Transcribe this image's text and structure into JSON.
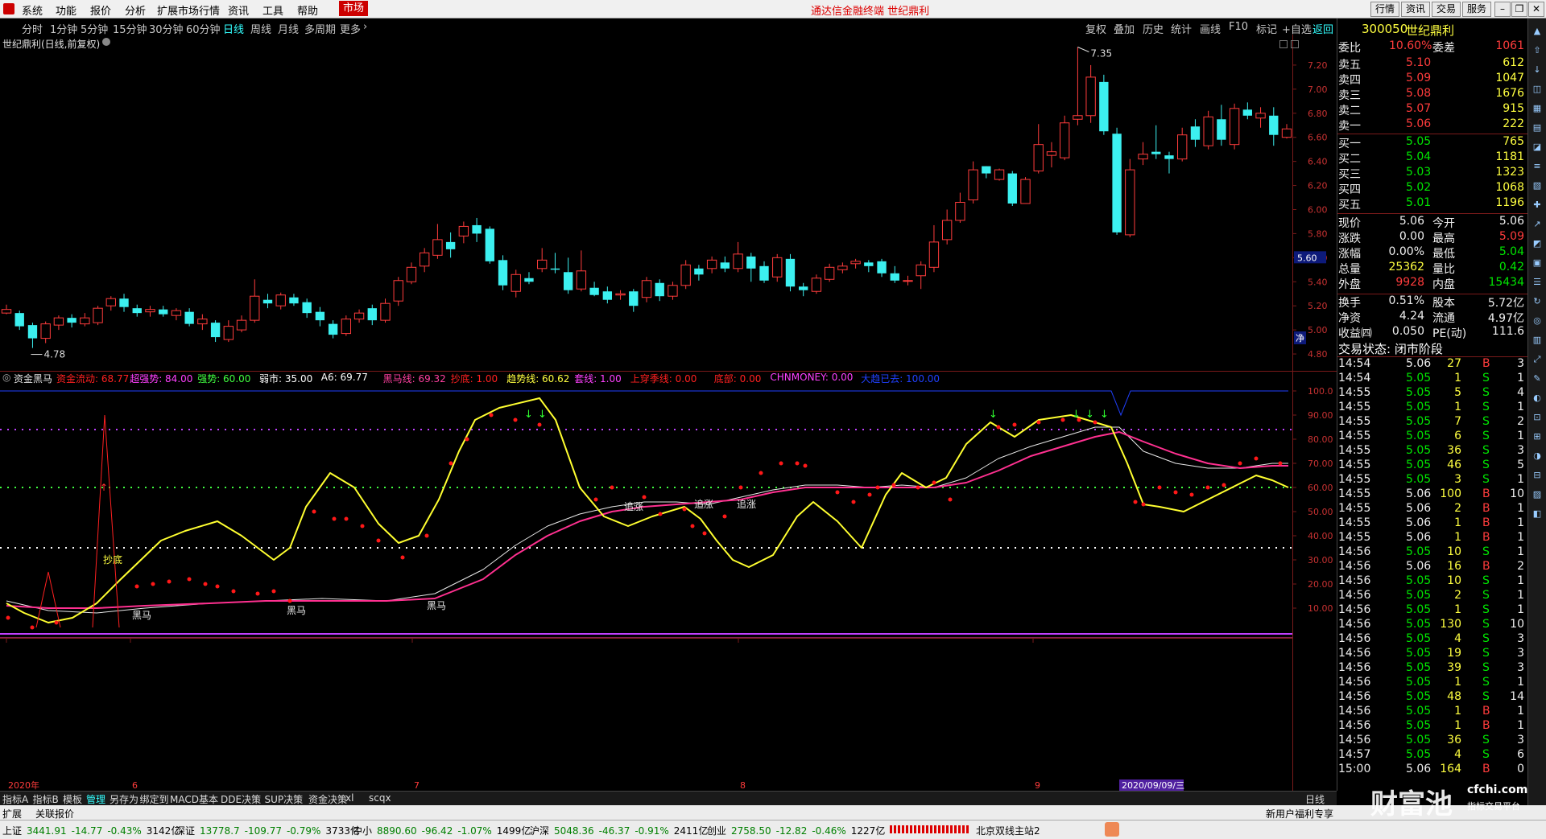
{
  "menu": {
    "items": [
      "系统",
      "功能",
      "报价",
      "分析",
      "扩展市场行情",
      "资讯",
      "工具",
      "帮助"
    ],
    "active": "市场",
    "ad_text": "通达信金融终端  世纪鼎利",
    "right_buttons": [
      "行情",
      "资讯",
      "交易",
      "服务"
    ]
  },
  "periods": [
    "分时",
    "1分钟",
    "5分钟",
    "15分钟",
    "30分钟",
    "60分钟",
    "日线",
    "周线",
    "月线",
    "多周期",
    "更多"
  ],
  "selected_period": "日线",
  "toolbar_right": [
    "复权",
    "叠加",
    "历史",
    "统计",
    "画线",
    "F10",
    "标记",
    "+自选",
    "返回"
  ],
  "stock": {
    "code": "300050",
    "name": "世纪鼎利"
  },
  "chart_title": "世纪鼎利(日线,前复权)",
  "price_axis": [
    "7.20",
    "7.00",
    "6.80",
    "6.60",
    "6.40",
    "6.20",
    "6.00",
    "5.80",
    "5.60",
    "5.40",
    "5.20",
    "5.00",
    "4.80"
  ],
  "price_marker": "5.60",
  "high_label": "7.35",
  "low_label": "4.78",
  "indicator": {
    "name": "资金黑马",
    "values": [
      {
        "label": "资金流动: 68.77",
        "color": "#ff2020"
      },
      {
        "label": "超强势: 84.00",
        "color": "#ff40ff"
      },
      {
        "label": "强势: 60.00",
        "color": "#40ff40"
      },
      {
        "label": "弱市: 35.00",
        "color": "#ffffff"
      },
      {
        "label": "A6: 69.77",
        "color": "#ffffff"
      },
      {
        "label": "黑马线: 69.32",
        "color": "#ff40a0"
      },
      {
        "label": "抄底: 1.00",
        "color": "#ff2020"
      },
      {
        "label": "趋势线: 60.62",
        "color": "#ffff40"
      },
      {
        "label": "套线: 1.00",
        "color": "#ff40ff"
      },
      {
        "label": "上穿季线: 0.00",
        "color": "#ff2020"
      },
      {
        "label": "底部: 0.00",
        "color": "#ff2020"
      },
      {
        "label": "CHNMONEY: 0.00",
        "color": "#ff40ff"
      },
      {
        "label": "大趋已去: 100.00",
        "color": "#2040ff"
      }
    ],
    "axis": [
      "100.0",
      "90.00",
      "80.00",
      "70.00",
      "60.00",
      "50.00",
      "40.00",
      "30.00",
      "20.00",
      "10.00"
    ],
    "labels": {
      "dima": "黑马",
      "chaodi": "抄底",
      "zhuizhang": "追涨"
    }
  },
  "date_axis": [
    {
      "label": "2020年",
      "color": "#ff3c3c"
    },
    {
      "label": "6",
      "color": "#ff3c3c"
    },
    {
      "label": "7",
      "color": "#ff3c3c"
    },
    {
      "label": "8",
      "color": "#ff3c3c"
    },
    {
      "label": "9",
      "color": "#ff3c3c"
    }
  ],
  "date_cursor": "2020/09/09/三",
  "bottom_tabs": [
    "指标A",
    "指标B",
    "模板",
    "管理",
    "另存为",
    "绑定到",
    "MACD基本",
    "DDE决策",
    "SUP决策",
    "资金决策",
    "xl",
    "scqx"
  ],
  "selected_tab": "管理",
  "daily_label": "日线",
  "order_book": {
    "weibi": {
      "label": "委比",
      "value": "10.60%",
      "label2": "委差",
      "value2": "1061"
    },
    "sells": [
      {
        "label": "卖五",
        "price": "5.10",
        "vol": "612"
      },
      {
        "label": "卖四",
        "price": "5.09",
        "vol": "1047"
      },
      {
        "label": "卖三",
        "price": "5.08",
        "vol": "1676"
      },
      {
        "label": "卖二",
        "price": "5.07",
        "vol": "915"
      },
      {
        "label": "卖一",
        "price": "5.06",
        "vol": "222"
      }
    ],
    "buys": [
      {
        "label": "买一",
        "price": "5.05",
        "vol": "765"
      },
      {
        "label": "买二",
        "price": "5.04",
        "vol": "1181"
      },
      {
        "label": "买三",
        "price": "5.03",
        "vol": "1323"
      },
      {
        "label": "买四",
        "price": "5.02",
        "vol": "1068"
      },
      {
        "label": "买五",
        "price": "5.01",
        "vol": "1196"
      }
    ]
  },
  "quote": [
    {
      "l1": "现价",
      "v1": "5.06",
      "c1": "white",
      "l2": "今开",
      "v2": "5.06",
      "c2": "white"
    },
    {
      "l1": "涨跌",
      "v1": "0.00",
      "c1": "white",
      "l2": "最高",
      "v2": "5.09",
      "c2": "red"
    },
    {
      "l1": "涨幅",
      "v1": "0.00%",
      "c1": "white",
      "l2": "最低",
      "v2": "5.04",
      "c2": "green"
    },
    {
      "l1": "总量",
      "v1": "25362",
      "c1": "yellow",
      "l2": "量比",
      "v2": "0.42",
      "c2": "green"
    },
    {
      "l1": "外盘",
      "v1": "9928",
      "c1": "red",
      "l2": "内盘",
      "v2": "15434",
      "c2": "green"
    },
    {
      "l1": "换手",
      "v1": "0.51%",
      "c1": "white",
      "l2": "股本",
      "v2": "5.72亿",
      "c2": "white"
    },
    {
      "l1": "净资",
      "v1": "4.24",
      "c1": "white",
      "l2": "流通",
      "v2": "4.97亿",
      "c2": "white"
    },
    {
      "l1": "收益㈣",
      "v1": "0.050",
      "c1": "white",
      "l2": "PE(动)",
      "v2": "111.6",
      "c2": "white"
    }
  ],
  "trade_status": "交易状态: 闭市阶段",
  "ticks": [
    {
      "t": "14:54",
      "p": "5.06",
      "pc": "white",
      "v": "27",
      "s": "B",
      "n": "3"
    },
    {
      "t": "14:54",
      "p": "5.05",
      "pc": "green",
      "v": "1",
      "s": "S",
      "n": "1"
    },
    {
      "t": "14:55",
      "p": "5.05",
      "pc": "green",
      "v": "5",
      "s": "S",
      "n": "4"
    },
    {
      "t": "14:55",
      "p": "5.05",
      "pc": "green",
      "v": "1",
      "s": "S",
      "n": "1"
    },
    {
      "t": "14:55",
      "p": "5.05",
      "pc": "green",
      "v": "7",
      "s": "S",
      "n": "2"
    },
    {
      "t": "14:55",
      "p": "5.05",
      "pc": "green",
      "v": "6",
      "s": "S",
      "n": "1"
    },
    {
      "t": "14:55",
      "p": "5.05",
      "pc": "green",
      "v": "36",
      "s": "S",
      "n": "3"
    },
    {
      "t": "14:55",
      "p": "5.05",
      "pc": "green",
      "v": "46",
      "s": "S",
      "n": "5"
    },
    {
      "t": "14:55",
      "p": "5.05",
      "pc": "green",
      "v": "3",
      "s": "S",
      "n": "1"
    },
    {
      "t": "14:55",
      "p": "5.06",
      "pc": "white",
      "v": "100",
      "s": "B",
      "n": "10"
    },
    {
      "t": "14:55",
      "p": "5.06",
      "pc": "white",
      "v": "2",
      "s": "B",
      "n": "1"
    },
    {
      "t": "14:55",
      "p": "5.06",
      "pc": "white",
      "v": "1",
      "s": "B",
      "n": "1"
    },
    {
      "t": "14:55",
      "p": "5.06",
      "pc": "white",
      "v": "1",
      "s": "B",
      "n": "1"
    },
    {
      "t": "14:56",
      "p": "5.05",
      "pc": "green",
      "v": "10",
      "s": "S",
      "n": "1"
    },
    {
      "t": "14:56",
      "p": "5.06",
      "pc": "white",
      "v": "16",
      "s": "B",
      "n": "2"
    },
    {
      "t": "14:56",
      "p": "5.05",
      "pc": "green",
      "v": "10",
      "s": "S",
      "n": "1"
    },
    {
      "t": "14:56",
      "p": "5.05",
      "pc": "green",
      "v": "2",
      "s": "S",
      "n": "1"
    },
    {
      "t": "14:56",
      "p": "5.05",
      "pc": "green",
      "v": "1",
      "s": "S",
      "n": "1"
    },
    {
      "t": "14:56",
      "p": "5.05",
      "pc": "green",
      "v": "130",
      "s": "S",
      "n": "10"
    },
    {
      "t": "14:56",
      "p": "5.05",
      "pc": "green",
      "v": "4",
      "s": "S",
      "n": "3"
    },
    {
      "t": "14:56",
      "p": "5.05",
      "pc": "green",
      "v": "19",
      "s": "S",
      "n": "3"
    },
    {
      "t": "14:56",
      "p": "5.05",
      "pc": "green",
      "v": "39",
      "s": "S",
      "n": "3"
    },
    {
      "t": "14:56",
      "p": "5.05",
      "pc": "green",
      "v": "1",
      "s": "S",
      "n": "1"
    },
    {
      "t": "14:56",
      "p": "5.05",
      "pc": "green",
      "v": "48",
      "s": "S",
      "n": "14"
    },
    {
      "t": "14:56",
      "p": "5.05",
      "pc": "green",
      "v": "1",
      "s": "B",
      "n": "1"
    },
    {
      "t": "14:56",
      "p": "5.05",
      "pc": "green",
      "v": "1",
      "s": "B",
      "n": "1"
    },
    {
      "t": "14:56",
      "p": "5.05",
      "pc": "green",
      "v": "36",
      "s": "S",
      "n": "3"
    },
    {
      "t": "14:57",
      "p": "5.05",
      "pc": "green",
      "v": "4",
      "s": "S",
      "n": "6"
    },
    {
      "t": "15:00",
      "p": "5.06",
      "pc": "white",
      "v": "164",
      "s": "B",
      "n": "0"
    }
  ],
  "bar2": {
    "left": [
      "扩展",
      "关联报价"
    ],
    "right": "新用户福利专享"
  },
  "index_bar": [
    {
      "name": "上证",
      "val": "3441.91",
      "chg": "-14.77",
      "pct": "-0.43%",
      "amt": "3142亿"
    },
    {
      "name": "深证",
      "val": "13778.7",
      "chg": "-109.77",
      "pct": "-0.79%",
      "amt": "3733亿"
    },
    {
      "name": "中小",
      "val": "8890.60",
      "chg": "-96.42",
      "pct": "-1.07%",
      "amt": "1499亿"
    },
    {
      "name": "沪深",
      "val": "5048.36",
      "chg": "-46.37",
      "pct": "-0.91%",
      "amt": "2411亿"
    },
    {
      "name": "创业",
      "val": "2758.50",
      "chg": "-12.82",
      "pct": "-0.46%",
      "amt": "1227亿"
    }
  ],
  "station": "北京双线主站2",
  "watermark": {
    "brand": "财富池",
    "site": "cfchi.com",
    "slogan": "指标交易平台"
  },
  "chart_data": {
    "type": "candlestick",
    "ylim": [
      4.7,
      7.4
    ],
    "candles": [
      [
        5.14,
        5.17,
        5.13,
        5.21
      ],
      [
        5.14,
        5.03,
        5.0,
        5.16
      ],
      [
        5.04,
        4.93,
        4.85,
        5.06
      ],
      [
        4.93,
        5.05,
        4.89,
        5.07
      ],
      [
        5.04,
        5.1,
        5.0,
        5.12
      ],
      [
        5.1,
        5.06,
        5.02,
        5.13
      ],
      [
        5.05,
        5.1,
        5.03,
        5.14
      ],
      [
        5.06,
        5.18,
        5.04,
        5.2
      ],
      [
        5.2,
        5.26,
        5.16,
        5.28
      ],
      [
        5.26,
        5.19,
        5.15,
        5.3
      ],
      [
        5.18,
        5.14,
        5.11,
        5.21
      ],
      [
        5.15,
        5.17,
        5.11,
        5.2
      ],
      [
        5.17,
        5.13,
        5.11,
        5.2
      ],
      [
        5.12,
        5.16,
        5.08,
        5.18
      ],
      [
        5.15,
        5.05,
        5.03,
        5.18
      ],
      [
        5.05,
        5.09,
        5.0,
        5.13
      ],
      [
        5.06,
        4.94,
        4.9,
        5.08
      ],
      [
        4.92,
        5.03,
        4.9,
        5.08
      ],
      [
        5.0,
        5.08,
        4.98,
        5.12
      ],
      [
        5.08,
        5.28,
        5.06,
        5.42
      ],
      [
        5.25,
        5.22,
        5.18,
        5.3
      ],
      [
        5.2,
        5.29,
        5.17,
        5.31
      ],
      [
        5.27,
        5.22,
        5.2,
        5.3
      ],
      [
        5.23,
        5.14,
        5.1,
        5.26
      ],
      [
        5.15,
        5.08,
        5.03,
        5.19
      ],
      [
        5.05,
        4.96,
        4.93,
        5.08
      ],
      [
        4.97,
        5.09,
        4.95,
        5.12
      ],
      [
        5.09,
        5.14,
        5.06,
        5.17
      ],
      [
        5.18,
        5.08,
        5.04,
        5.21
      ],
      [
        5.08,
        5.22,
        5.06,
        5.26
      ],
      [
        5.24,
        5.41,
        5.2,
        5.44
      ],
      [
        5.4,
        5.52,
        5.38,
        5.56
      ],
      [
        5.53,
        5.64,
        5.48,
        5.68
      ],
      [
        5.62,
        5.75,
        5.59,
        5.88
      ],
      [
        5.73,
        5.67,
        5.6,
        5.81
      ],
      [
        5.78,
        5.86,
        5.72,
        5.9
      ],
      [
        5.87,
        5.8,
        5.73,
        5.93
      ],
      [
        5.84,
        5.57,
        5.55,
        5.86
      ],
      [
        5.58,
        5.37,
        5.33,
        5.62
      ],
      [
        5.32,
        5.46,
        5.27,
        5.5
      ],
      [
        5.43,
        5.4,
        5.38,
        5.48
      ],
      [
        5.51,
        5.58,
        5.48,
        5.68
      ],
      [
        5.51,
        5.5,
        5.47,
        5.64
      ],
      [
        5.48,
        5.33,
        5.3,
        5.6
      ],
      [
        5.34,
        5.49,
        5.32,
        5.66
      ],
      [
        5.35,
        5.29,
        5.28,
        5.4
      ],
      [
        5.32,
        5.25,
        5.22,
        5.36
      ],
      [
        5.29,
        5.3,
        5.25,
        5.33
      ],
      [
        5.32,
        5.2,
        5.15,
        5.34
      ],
      [
        5.27,
        5.41,
        5.23,
        5.44
      ],
      [
        5.39,
        5.28,
        5.24,
        5.42
      ],
      [
        5.28,
        5.37,
        5.25,
        5.4
      ],
      [
        5.37,
        5.54,
        5.34,
        5.58
      ],
      [
        5.51,
        5.46,
        5.41,
        5.54
      ],
      [
        5.51,
        5.58,
        5.47,
        5.61
      ],
      [
        5.56,
        5.51,
        5.48,
        5.61
      ],
      [
        5.51,
        5.63,
        5.48,
        5.73
      ],
      [
        5.61,
        5.51,
        5.4,
        5.64
      ],
      [
        5.53,
        5.41,
        5.39,
        5.57
      ],
      [
        5.44,
        5.6,
        5.4,
        5.63
      ],
      [
        5.59,
        5.36,
        5.32,
        5.63
      ],
      [
        5.36,
        5.33,
        5.28,
        5.39
      ],
      [
        5.32,
        5.43,
        5.3,
        5.46
      ],
      [
        5.42,
        5.52,
        5.4,
        5.55
      ],
      [
        5.5,
        5.53,
        5.47,
        5.56
      ],
      [
        5.55,
        5.57,
        5.51,
        5.59
      ],
      [
        5.56,
        5.53,
        5.48,
        5.58
      ],
      [
        5.57,
        5.47,
        5.44,
        5.59
      ],
      [
        5.47,
        5.41,
        5.39,
        5.53
      ],
      [
        5.41,
        5.41,
        5.37,
        5.45
      ],
      [
        5.45,
        5.54,
        5.34,
        5.57
      ],
      [
        5.52,
        5.73,
        5.48,
        5.87
      ],
      [
        5.75,
        5.91,
        5.71,
        6.0
      ],
      [
        5.91,
        6.06,
        5.89,
        6.14
      ],
      [
        6.08,
        6.33,
        6.05,
        6.4
      ],
      [
        6.36,
        6.3,
        6.26,
        6.36
      ],
      [
        6.25,
        6.33,
        6.24,
        6.34
      ],
      [
        6.3,
        6.05,
        6.03,
        6.32
      ],
      [
        6.05,
        6.25,
        6.05,
        6.27
      ],
      [
        6.32,
        6.54,
        6.3,
        6.71
      ],
      [
        6.45,
        6.48,
        6.35,
        6.56
      ],
      [
        6.43,
        6.72,
        6.41,
        6.78
      ],
      [
        6.75,
        6.78,
        6.7,
        7.35
      ],
      [
        6.78,
        7.1,
        6.72,
        7.2
      ],
      [
        7.06,
        6.65,
        6.62,
        7.12
      ],
      [
        6.63,
        5.81,
        5.79,
        6.68
      ],
      [
        5.79,
        6.33,
        5.77,
        6.42
      ],
      [
        6.42,
        6.46,
        6.37,
        6.56
      ],
      [
        6.48,
        6.46,
        6.42,
        6.7
      ],
      [
        6.45,
        6.42,
        6.3,
        6.48
      ],
      [
        6.42,
        6.62,
        6.4,
        6.68
      ],
      [
        6.69,
        6.58,
        6.52,
        6.75
      ],
      [
        6.53,
        6.77,
        6.5,
        6.82
      ],
      [
        6.75,
        6.58,
        6.53,
        6.87
      ],
      [
        6.54,
        6.84,
        6.5,
        6.88
      ],
      [
        6.83,
        6.78,
        6.75,
        6.89
      ],
      [
        6.76,
        6.8,
        6.68,
        6.85
      ],
      [
        6.78,
        6.62,
        6.53,
        6.85
      ],
      [
        6.6,
        6.67,
        6.59,
        6.71
      ]
    ]
  }
}
